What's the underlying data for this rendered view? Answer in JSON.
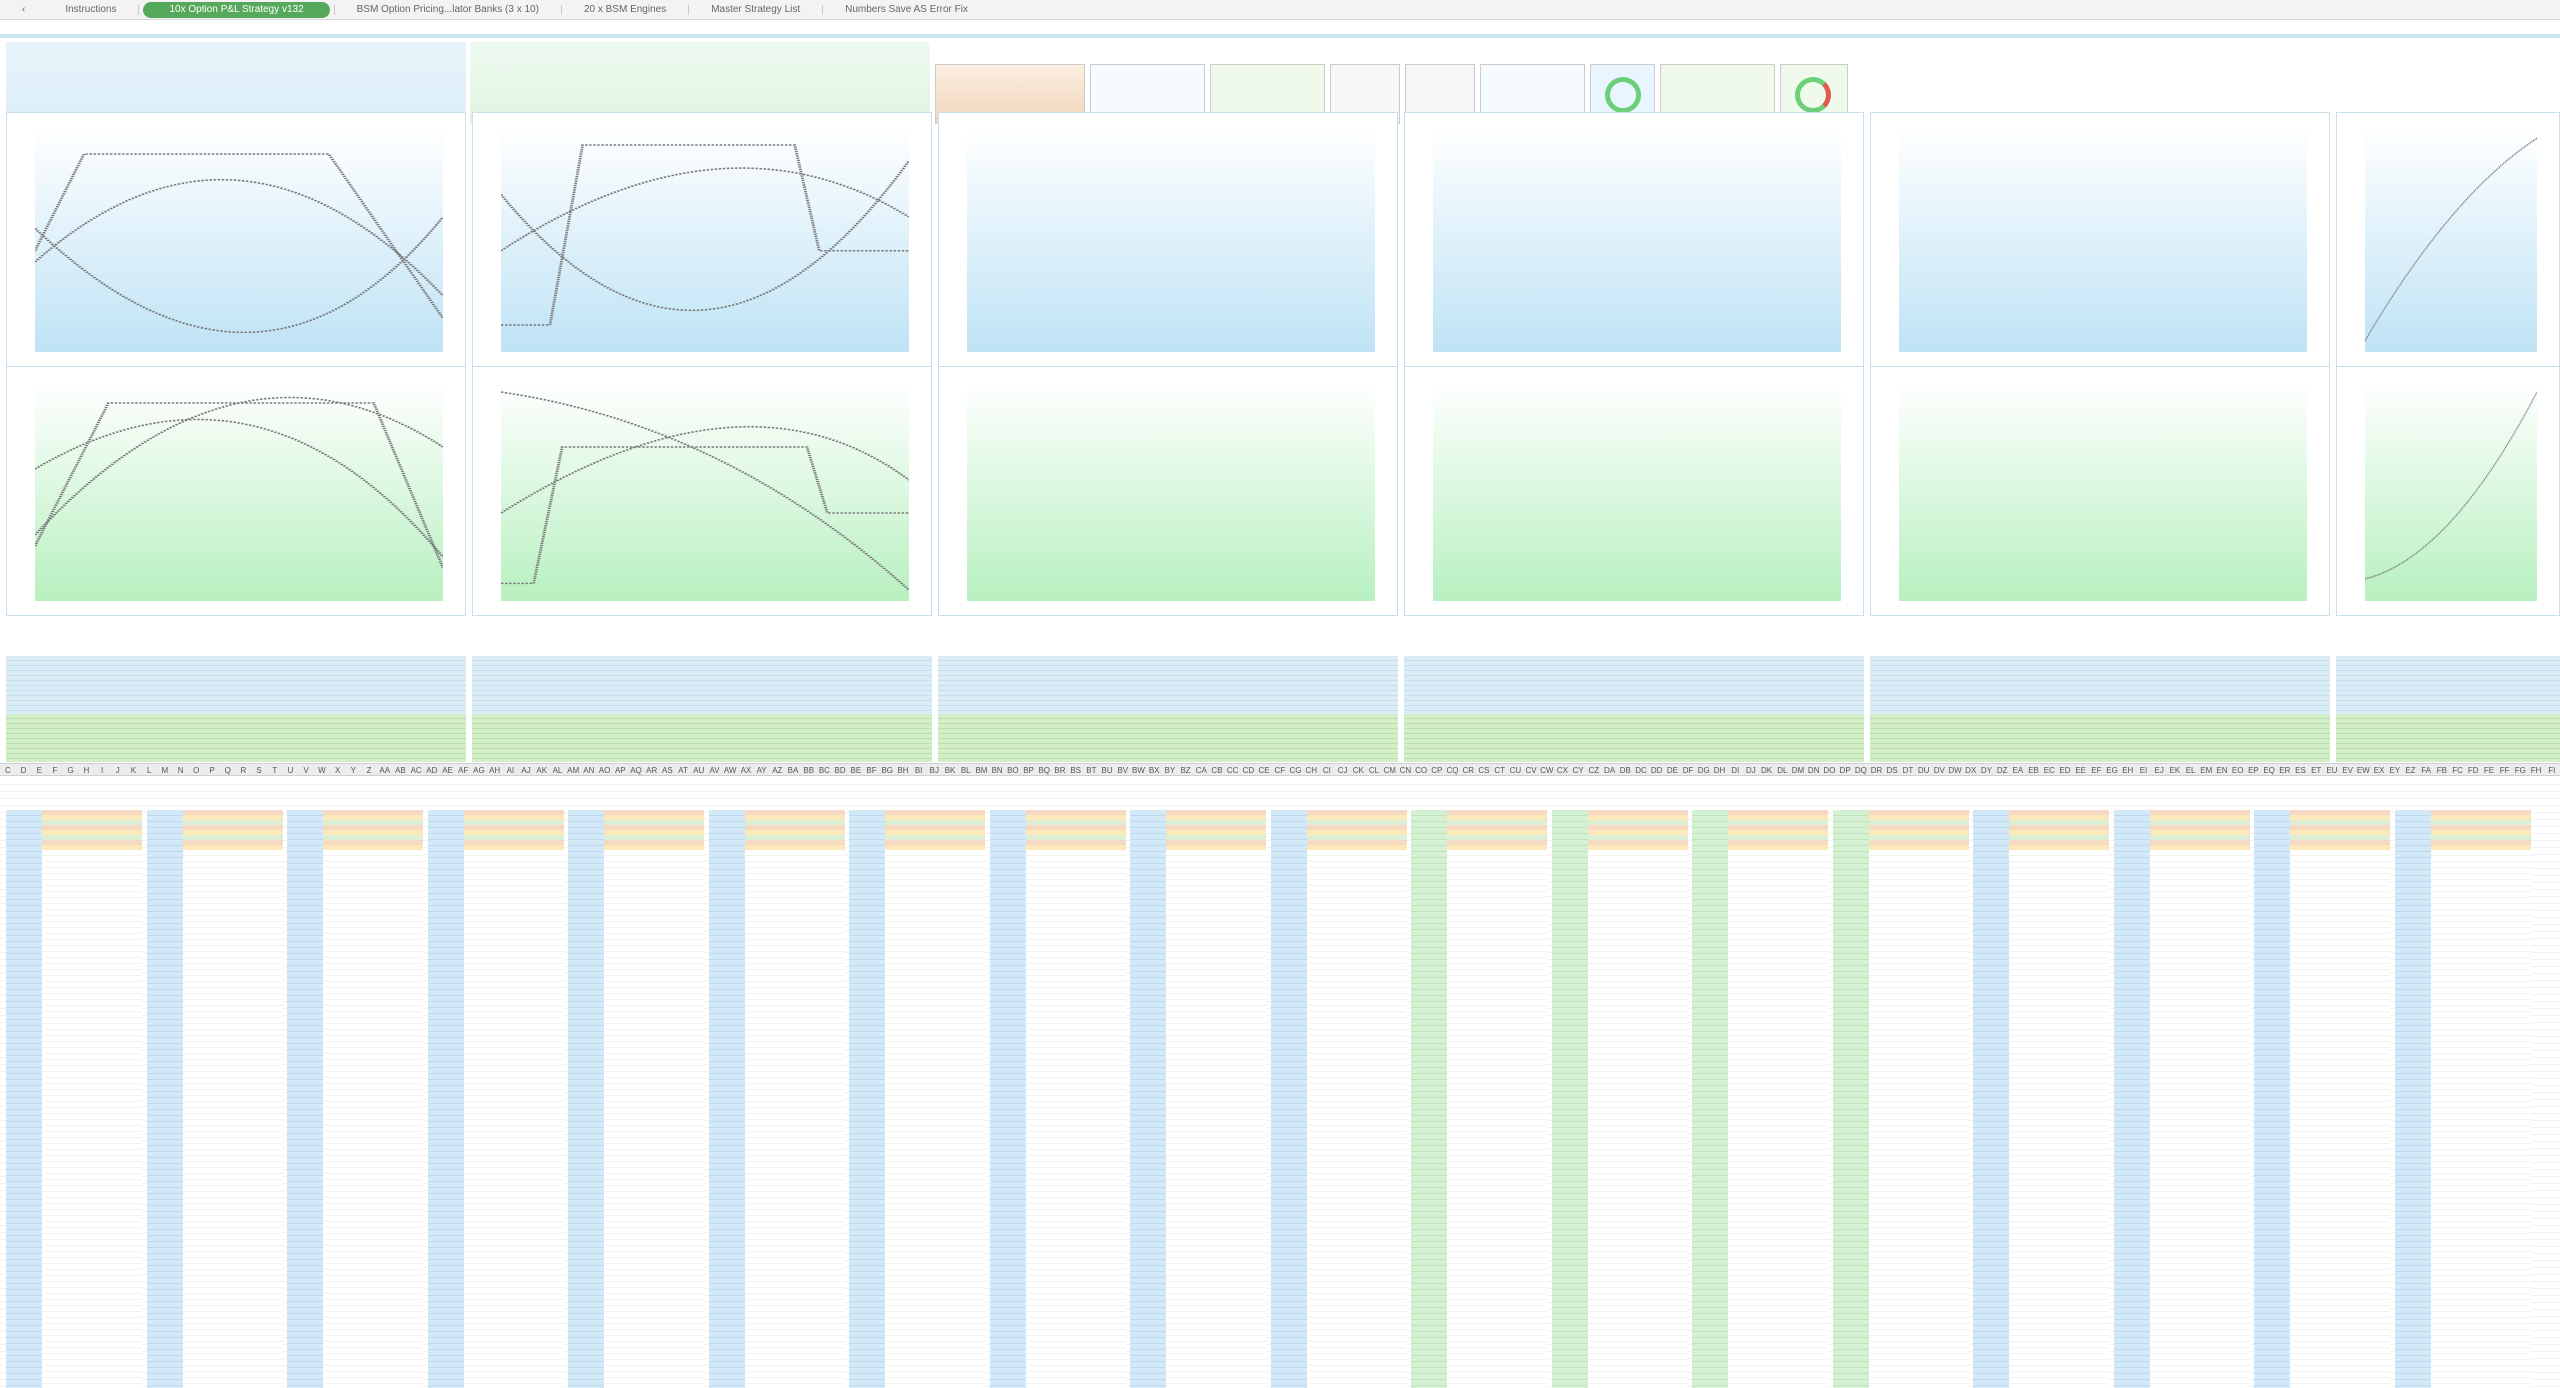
{
  "tabs": [
    {
      "label": "Instructions",
      "active": false
    },
    {
      "label": "10x Option P&L Strategy v132",
      "active": true
    },
    {
      "label": "BSM Option Pricing...lator Banks (3 x 10)",
      "active": false
    },
    {
      "label": "20 x BSM Engines",
      "active": false
    },
    {
      "label": "Master Strategy List",
      "active": false
    },
    {
      "label": "Numbers Save AS Error Fix",
      "active": false
    }
  ],
  "tab_prefix": "‹",
  "column_headers": [
    "C",
    "D",
    "E",
    "F",
    "G",
    "H",
    "I",
    "J",
    "K",
    "L",
    "M",
    "N",
    "O",
    "P",
    "Q",
    "R",
    "S",
    "T",
    "U",
    "V",
    "W",
    "X",
    "Y",
    "Z",
    "AA",
    "AB",
    "AC",
    "AD",
    "AE",
    "AF",
    "AG",
    "AH",
    "AI",
    "AJ",
    "AK",
    "AL",
    "AM",
    "AN",
    "AO",
    "AP",
    "AQ",
    "AR",
    "AS",
    "AT",
    "AU",
    "AV",
    "AW",
    "AX",
    "AY",
    "AZ",
    "BA",
    "BB",
    "BC",
    "BD",
    "BE",
    "BF",
    "BG",
    "BH",
    "BI",
    "BJ",
    "BK",
    "BL",
    "BM",
    "BN",
    "BO",
    "BP",
    "BQ",
    "BR",
    "BS",
    "BT",
    "BU",
    "BV",
    "BW",
    "BX",
    "BY",
    "BZ",
    "CA",
    "CB",
    "CC",
    "CD",
    "CE",
    "CF",
    "CG",
    "CH",
    "CI",
    "CJ",
    "CK",
    "CL",
    "CM",
    "CN",
    "CO",
    "CP",
    "CQ",
    "CR",
    "CS",
    "CT",
    "CU",
    "CV",
    "CW",
    "CX",
    "CY",
    "CZ",
    "DA",
    "DB",
    "DC",
    "DD",
    "DE",
    "DF",
    "DG",
    "DH",
    "DI",
    "DJ",
    "DK",
    "DL",
    "DM",
    "DN",
    "DO",
    "DP",
    "DQ",
    "DR",
    "DS",
    "DT",
    "DU",
    "DV",
    "DW",
    "DX",
    "DY",
    "DZ",
    "EA",
    "EB",
    "EC",
    "ED",
    "EE",
    "EF",
    "EG",
    "EH",
    "EI",
    "EJ",
    "EK",
    "EL",
    "EM",
    "EN",
    "EO",
    "EP",
    "EQ",
    "ER",
    "ES",
    "ET",
    "EU",
    "EV",
    "EW",
    "EX",
    "EY",
    "EZ",
    "FA",
    "FB",
    "FC",
    "FD",
    "FE",
    "FF",
    "FG",
    "FH",
    "FI"
  ],
  "colors": {
    "tab_active": "#56a85a",
    "plot_blue": "#bfe3f5",
    "plot_green": "#b8f0c0",
    "line": "#7a7a7a"
  }
}
